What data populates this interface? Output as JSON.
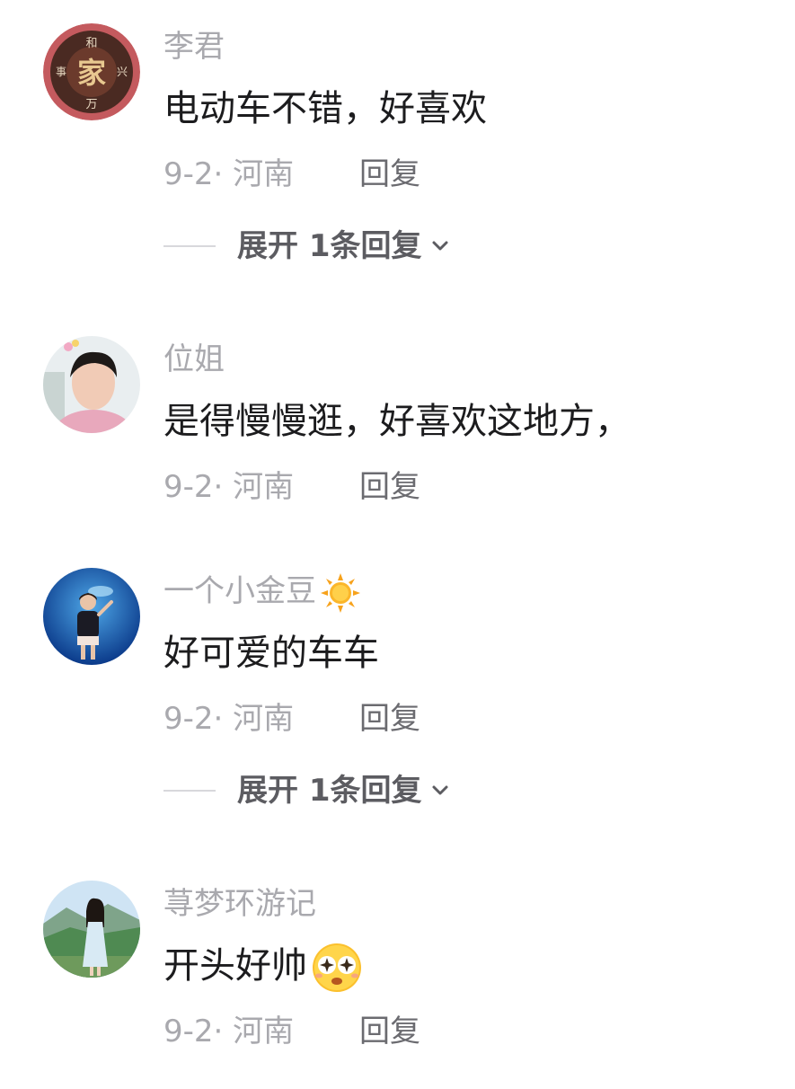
{
  "comments": [
    {
      "username": "李君",
      "text": "电动车不错，好喜欢",
      "meta": "9-2· 河南",
      "reply_label": "回复",
      "expand_label": "展开 1条回复",
      "avatar": "avatar-jia-seal-icon"
    },
    {
      "username": "位姐",
      "text": "是得慢慢逛，好喜欢这地方，",
      "meta": "9-2· 河南",
      "reply_label": "回复",
      "avatar": "avatar-woman-portrait"
    },
    {
      "username": "一个小金豆",
      "username_emoji": "sun-emoji-icon",
      "text": "好可爱的车车",
      "meta": "9-2· 河南",
      "reply_label": "回复",
      "expand_label": "展开 1条回复",
      "avatar": "avatar-aquarium-photo"
    },
    {
      "username": "荨梦环游记",
      "text": "开头好帅",
      "text_emoji": "starry-eyes-emoji-icon",
      "meta": "9-2· 河南",
      "reply_label": "回复",
      "avatar": "avatar-mountain-photo"
    }
  ],
  "colors": {
    "username": "#a9a9ae",
    "text": "#1c1c1e",
    "meta": "#a9a9ae",
    "reply": "#6b6b70",
    "expand": "#5c5c61"
  }
}
